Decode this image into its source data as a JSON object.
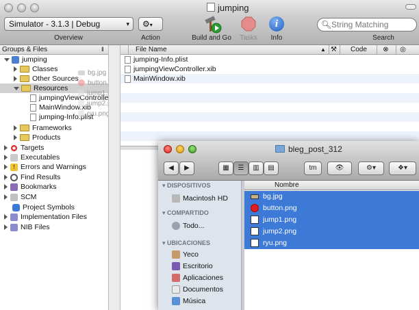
{
  "window": {
    "title": "jumping"
  },
  "toolbar": {
    "overview_value": "Simulator - 3.1.3 | Debug",
    "overview_label": "Overview",
    "action_label": "Action",
    "build_label": "Build and Go",
    "tasks_label": "Tasks",
    "info_label": "Info",
    "search_placeholder": "String Matching",
    "search_label": "Search"
  },
  "left_panel": {
    "header": "Groups & Files",
    "items": [
      {
        "label": "jumping"
      },
      {
        "label": "Classes"
      },
      {
        "label": "Other Sources"
      },
      {
        "label": "Resources"
      },
      {
        "label": "jumpingViewControlle"
      },
      {
        "label": "MainWindow.xib"
      },
      {
        "label": "jumping-Info.plist"
      },
      {
        "label": "Frameworks"
      },
      {
        "label": "Products"
      },
      {
        "label": "Targets"
      },
      {
        "label": "Executables"
      },
      {
        "label": "Errors and Warnings"
      },
      {
        "label": "Find Results"
      },
      {
        "label": "Bookmarks"
      },
      {
        "label": "SCM"
      },
      {
        "label": "Project Symbols"
      },
      {
        "label": "Implementation Files"
      },
      {
        "label": "NIB Files"
      }
    ],
    "drag_ghost": [
      "bg.jpg",
      "button.png",
      "jump1.png",
      "jump2.png",
      "ryu.png"
    ]
  },
  "right_panel": {
    "col_filename": "File Name",
    "col_code": "Code",
    "files": [
      "jumping-Info.plist",
      "jumpingViewController.xib",
      "MainWindow.xib"
    ]
  },
  "finder": {
    "title": "bleg_post_312",
    "tm_label": "tm",
    "sidebar": {
      "devices_heading": "DISPOSITIVOS",
      "macintosh": "Macintosh HD",
      "shared_heading": "COMPARTIDO",
      "all": "Todo...",
      "places_heading": "UBICACIONES",
      "places": [
        "Yeco",
        "Escritorio",
        "Aplicaciones",
        "Documentos",
        "Música"
      ]
    },
    "col_name": "Nombre",
    "files": [
      "bg.jpg",
      "button.png",
      "jump1.png",
      "jump2.png",
      "ryu.png"
    ]
  },
  "colors": {
    "selection": "#3d79d6",
    "sidebar_bg": "#dde4ec",
    "stripe": "#edf2fb"
  }
}
